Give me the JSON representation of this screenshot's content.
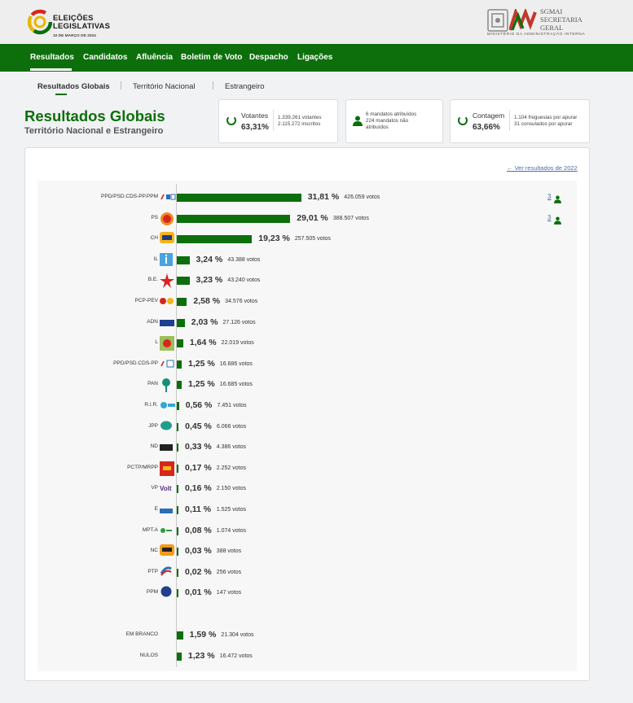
{
  "header": {
    "logo_title_line1": "ELEIÇÕES",
    "logo_title_line2": "LEGISLATIVAS",
    "logo_date": "10 DE MARÇO DE 2024",
    "sgmai_line1": "SGMAI",
    "sgmai_line2": "SECRETARIA",
    "sgmai_line3": "GERAL",
    "ministry": "MINISTÉRIO DA ADMINISTRAÇÃO INTERNA"
  },
  "nav": {
    "items": [
      "Resultados",
      "Candidatos",
      "Afluência",
      "Boletim de Voto",
      "Despacho",
      "Ligações"
    ]
  },
  "subtabs": [
    "Resultados Globais",
    "Território Nacional",
    "Estrangeiro"
  ],
  "title": "Resultados Globais",
  "subtitle": "Território Nacional e Estrangeiro",
  "stats": {
    "votantes": {
      "label": "Votantes",
      "pct": "63,31%",
      "line1": "1.339.261 votantes",
      "line2": "2.115.272 inscritos"
    },
    "mandatos": {
      "line1": "6 mandatos atribuídos",
      "line2": "224 mandatos não",
      "line3": "atribuídos"
    },
    "contagem": {
      "label": "Contagem",
      "pct": "63,66%",
      "line1": "1.104 freguesias por apurar",
      "line2": "31 consulados por apurar"
    }
  },
  "prev_results_link": "Ver resultados de 2022",
  "results": [
    {
      "party": "PPD/PSD.CDS-PP.PPM",
      "pct": "31,81 %",
      "votes": "426.059 votos",
      "share": 31.81,
      "seats": "3",
      "logo": "ad-logo"
    },
    {
      "party": "PS",
      "pct": "29,01 %",
      "votes": "388.507 votos",
      "share": 29.01,
      "seats": "3",
      "logo": "ps-logo"
    },
    {
      "party": "CH",
      "pct": "19,23 %",
      "votes": "257.505 votos",
      "share": 19.23,
      "logo": "ch-logo"
    },
    {
      "party": "IL",
      "pct": "3,24 %",
      "votes": "43.388 votos",
      "share": 3.24,
      "logo": "il-logo"
    },
    {
      "party": "B.E.",
      "pct": "3,23 %",
      "votes": "43.240 votos",
      "share": 3.23,
      "logo": "be-logo"
    },
    {
      "party": "PCP-PEV",
      "pct": "2,58 %",
      "votes": "34.576 votos",
      "share": 2.58,
      "logo": "cdu-logo"
    },
    {
      "party": "ADN",
      "pct": "2,03 %",
      "votes": "27.126 votos",
      "share": 2.03,
      "logo": "adn-logo"
    },
    {
      "party": "L",
      "pct": "1,64 %",
      "votes": "22.019 votos",
      "share": 1.64,
      "logo": "livre-logo"
    },
    {
      "party": "PPD/PSD.CDS-PP",
      "pct": "1,25 %",
      "votes": "16.686 votos",
      "share": 1.25,
      "logo": "psd-cds-logo"
    },
    {
      "party": "PAN",
      "pct": "1,25 %",
      "votes": "16.685 votos",
      "share": 1.25,
      "logo": "pan-logo"
    },
    {
      "party": "R.I.R.",
      "pct": "0,56 %",
      "votes": "7.451 votos",
      "share": 0.56,
      "logo": "rir-logo"
    },
    {
      "party": "JPP",
      "pct": "0,45 %",
      "votes": "6.066 votos",
      "share": 0.45,
      "logo": "jpp-logo"
    },
    {
      "party": "ND",
      "pct": "0,33 %",
      "votes": "4.386 votos",
      "share": 0.33,
      "logo": "nd-logo"
    },
    {
      "party": "PCTP/MRPP",
      "pct": "0,17 %",
      "votes": "2.252 votos",
      "share": 0.17,
      "logo": "mrpp-logo"
    },
    {
      "party": "VP",
      "pct": "0,16 %",
      "votes": "2.150 votos",
      "share": 0.16,
      "logo": "volt-logo"
    },
    {
      "party": "E",
      "pct": "0,11 %",
      "votes": "1.525 votos",
      "share": 0.11,
      "logo": "ergue-te-logo"
    },
    {
      "party": "MPT.A",
      "pct": "0,08 %",
      "votes": "1.074 votos",
      "share": 0.08,
      "logo": "mpt-logo"
    },
    {
      "party": "NC",
      "pct": "0,03 %",
      "votes": "388 votos",
      "share": 0.03,
      "logo": "nc-logo"
    },
    {
      "party": "PTP",
      "pct": "0,02 %",
      "votes": "256 votos",
      "share": 0.02,
      "logo": "ptp-logo"
    },
    {
      "party": "PPM",
      "pct": "0,01 %",
      "votes": "147 votos",
      "share": 0.01,
      "logo": "ppm-logo"
    }
  ],
  "other_results": [
    {
      "party": "EM BRANCO",
      "pct": "1,59 %",
      "votes": "21.304 votos",
      "share": 1.59
    },
    {
      "party": "NULOS",
      "pct": "1,23 %",
      "votes": "16.472 votos",
      "share": 1.23
    }
  ],
  "colors": {
    "brand_green": "#0c6f0b",
    "link_blue": "#4a6fa5"
  }
}
